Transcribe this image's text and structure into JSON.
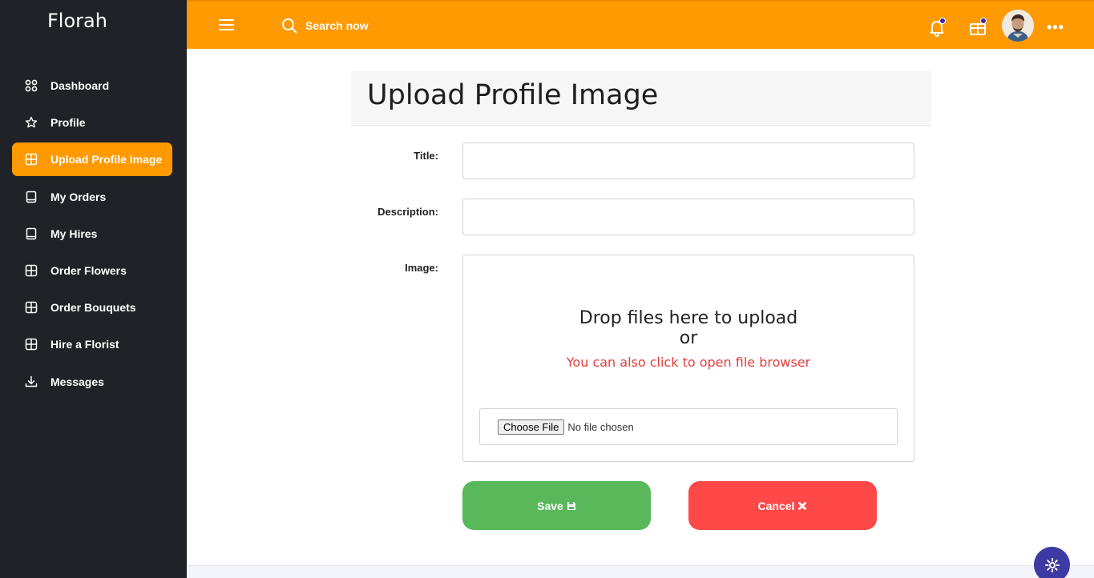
{
  "app": {
    "brand": "Florah"
  },
  "sidebar": {
    "items": [
      {
        "label": "Dashboard",
        "icon": "grid-circles-icon"
      },
      {
        "label": "Profile",
        "icon": "star-icon"
      },
      {
        "label": "Upload Profile Image",
        "icon": "grid-square-icon",
        "active": true
      },
      {
        "label": "My Orders",
        "icon": "book-icon"
      },
      {
        "label": "My Hires",
        "icon": "book-icon"
      },
      {
        "label": "Order Flowers",
        "icon": "grid-square-icon"
      },
      {
        "label": "Order Bouquets",
        "icon": "grid-square-icon"
      },
      {
        "label": "Hire a Florist",
        "icon": "grid-square-icon"
      },
      {
        "label": "Messages",
        "icon": "download-icon"
      }
    ]
  },
  "topbar": {
    "search_placeholder": "Search now",
    "icons": [
      "menu-icon",
      "search-icon",
      "bell-icon",
      "gift-icon",
      "avatar",
      "more-icon"
    ],
    "more": "•••"
  },
  "form": {
    "title": "Upload Profile Image",
    "title_label": "Title:",
    "description_label": "Description:",
    "image_label": "Image:",
    "dropzone": {
      "heading": "Drop files here to upload",
      "or": "or",
      "subtext": "You can also click to open file browser"
    },
    "file_input": {
      "button": "Choose File",
      "status": "No file chosen"
    },
    "save_label": "Save",
    "cancel_label": "Cancel"
  },
  "colors": {
    "sidebar_bg": "#212227",
    "accent": "#ff9a03",
    "save": "#58b85a",
    "cancel": "#ff4848",
    "dropzone_sub": "#e53e3e",
    "settings_fab": "#3d3aa3"
  }
}
